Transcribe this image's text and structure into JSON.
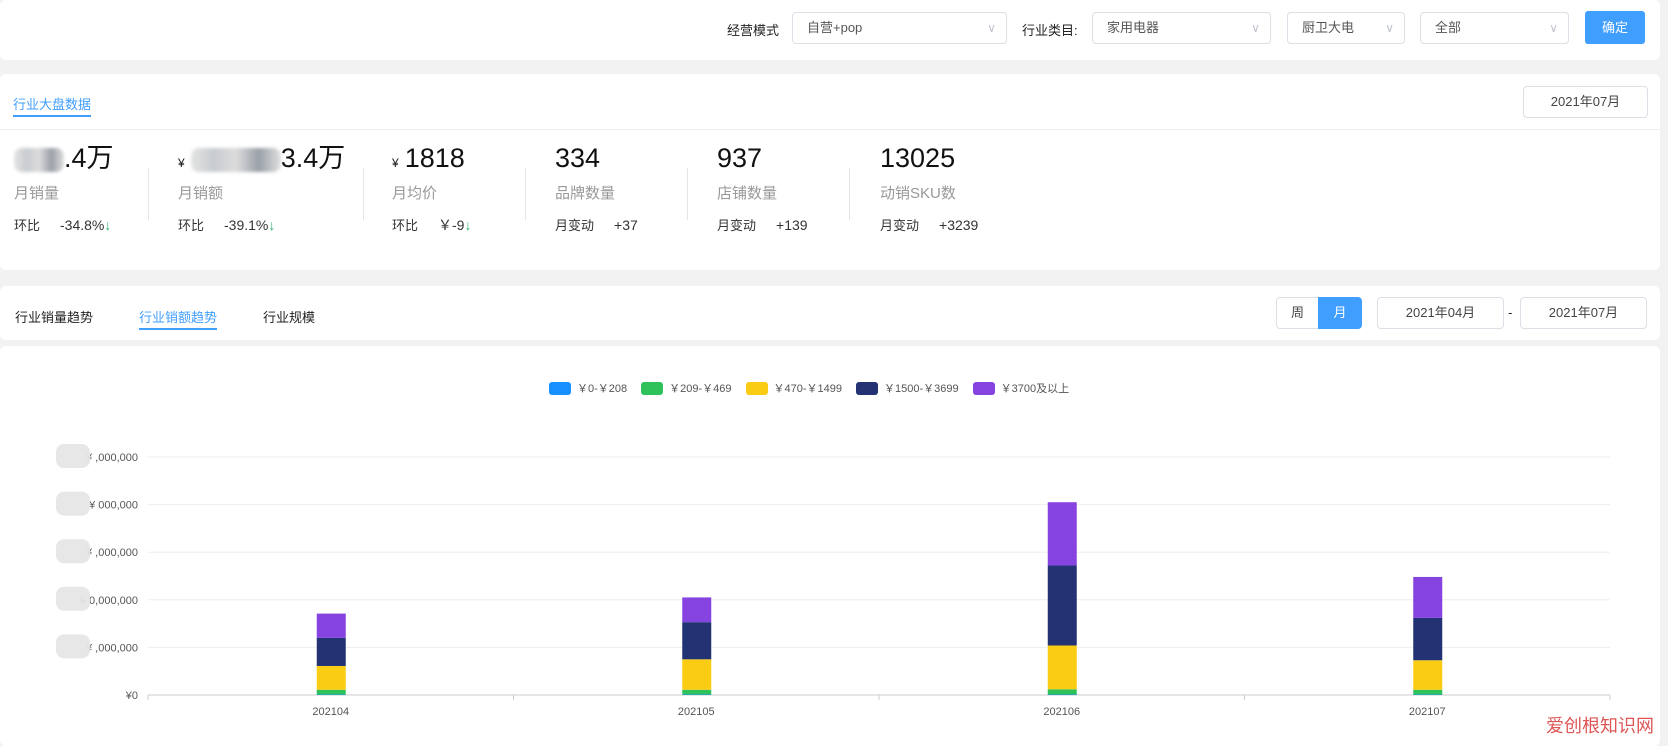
{
  "filters": {
    "mode_label": "经营模式",
    "mode_value": "自营+pop",
    "category_label": "行业类目:",
    "category_value": "家用电器",
    "subcategory_value": "厨卫大电",
    "scope_value": "全部",
    "confirm_label": "确定"
  },
  "overview": {
    "tab_label": "行业大盘数据",
    "date": "2021年07月",
    "metrics": [
      {
        "value_suffix": ".4万",
        "label": "月销量",
        "cmp_label": "环比",
        "cmp_value": "-34.8%",
        "arrow": "↓"
      },
      {
        "currency": "¥",
        "value_suffix": "3.4万",
        "label": "月销额",
        "cmp_label": "环比",
        "cmp_value": "-39.1%",
        "arrow": "↓"
      },
      {
        "currency": "¥",
        "value": "1818",
        "label": "月均价",
        "cmp_label": "环比",
        "cmp_value": "￥-9",
        "arrow": "↓"
      },
      {
        "value": "334",
        "label": "品牌数量",
        "cmp_label": "月变动",
        "cmp_value": "+37"
      },
      {
        "value": "937",
        "label": "店铺数量",
        "cmp_label": "月变动",
        "cmp_value": "+139"
      },
      {
        "value": "13025",
        "label": "动销SKU数",
        "cmp_label": "月变动",
        "cmp_value": "+3239"
      }
    ]
  },
  "trend": {
    "tabs": [
      "行业销量趋势",
      "行业销额趋势",
      "行业规模"
    ],
    "active_tab": 1,
    "period_week": "周",
    "period_month": "月",
    "date_from": "2021年04月",
    "date_sep": "-",
    "date_to": "2021年07月"
  },
  "chart_data": {
    "type": "bar",
    "stacked": true,
    "categories": [
      "202104",
      "202105",
      "202106",
      "202107"
    ],
    "series": [
      {
        "name": "￥0-￥208",
        "color": "#1890ff",
        "values": [
          0.01,
          0.01,
          0.01,
          0.01
        ]
      },
      {
        "name": "￥209-￥469",
        "color": "#2fc25b",
        "values": [
          0.1,
          0.1,
          0.11,
          0.1
        ]
      },
      {
        "name": "￥470-￥1499",
        "color": "#facc14",
        "values": [
          0.5,
          0.64,
          0.92,
          0.62
        ]
      },
      {
        "name": "￥1500-￥3699",
        "color": "#223273",
        "values": [
          0.59,
          0.78,
          1.68,
          0.89
        ]
      },
      {
        "name": "￥3700及以上",
        "color": "#8543e0",
        "values": [
          0.51,
          0.52,
          1.33,
          0.86
        ]
      }
    ],
    "y_unit_note": "values in units of one (obscured) y-axis tick step",
    "ylim": [
      0,
      5
    ],
    "ytick_labels": [
      "¥0",
      "¥ ,000,000",
      "¥ 0,000,000",
      "¥ ,000,000",
      "¥ 000,000",
      "¥ ,000,000"
    ],
    "legend_position": "top-center",
    "grid": true
  },
  "watermark": "爱创根知识网"
}
